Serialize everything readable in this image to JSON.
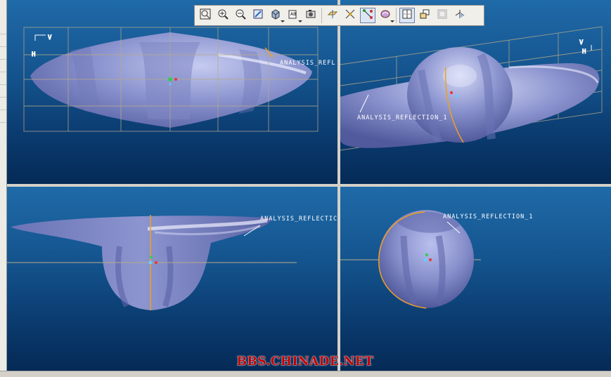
{
  "toolbar": {
    "buttons": [
      {
        "icon": "zoom-fit-icon"
      },
      {
        "icon": "zoom-in-icon"
      },
      {
        "icon": "zoom-out-icon"
      },
      {
        "icon": "repaint-icon"
      },
      {
        "icon": "shading-icon",
        "dropdown": true
      },
      {
        "icon": "saved-views-icon",
        "dropdown": true
      },
      {
        "icon": "view-manager-icon"
      },
      {
        "icon": "datum-planes-icon"
      },
      {
        "icon": "datum-axes-icon"
      },
      {
        "icon": "datum-points-icon",
        "active": true
      },
      {
        "icon": "coordinate-systems-icon",
        "dropdown": true
      },
      {
        "icon": "grid-display-icon",
        "active": true
      },
      {
        "icon": "spin-center-icon"
      },
      {
        "icon": "annotation-icon"
      },
      {
        "icon": "orientation-icon"
      }
    ]
  },
  "viewports": {
    "top_left": {
      "label": "ANALYSIS_REFL",
      "orient_h": "H",
      "orient_v": "V"
    },
    "top_right": {
      "label": "ANALYSIS_REFLECTION_1",
      "orient_h": "H",
      "orient_v": "V"
    },
    "bottom_left": {
      "label": "ANALYSIS_REFLECTIC"
    },
    "bottom_right": {
      "label": "ANALYSIS_REFLECTION_1"
    }
  },
  "watermark": "BBS.CHINADE.NET",
  "colors": {
    "background_top": "#1f6aa8",
    "background_bottom": "#052a56",
    "model": "#8c95cf",
    "reflection_curve": "#f0a020"
  }
}
